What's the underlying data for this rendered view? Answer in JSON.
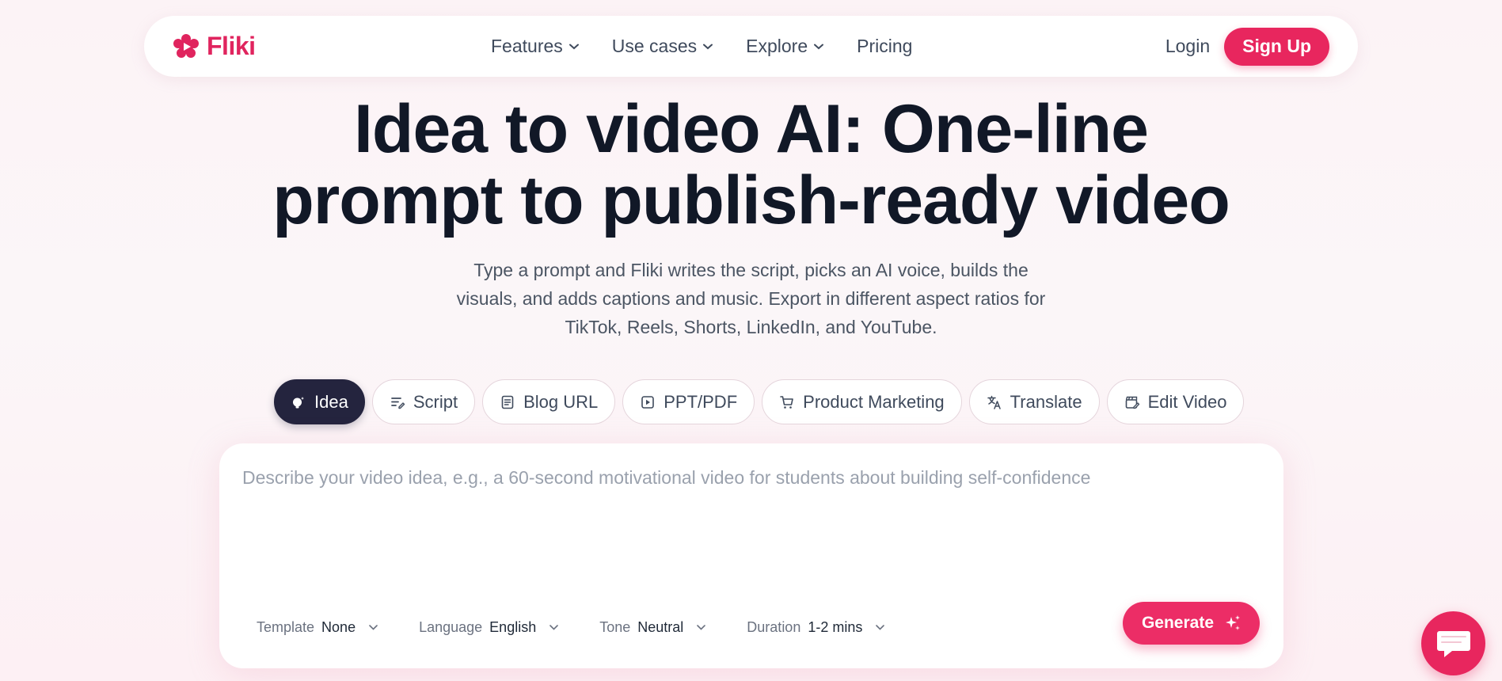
{
  "brand": {
    "name": "Fliki",
    "color": "#e0245e",
    "logo_icon": "flower-play-icon"
  },
  "nav": {
    "items": [
      {
        "label": "Features",
        "dropdown": true
      },
      {
        "label": "Use cases",
        "dropdown": true
      },
      {
        "label": "Explore",
        "dropdown": true
      },
      {
        "label": "Pricing",
        "dropdown": false
      }
    ],
    "login_label": "Login",
    "signup_label": "Sign Up"
  },
  "hero": {
    "title_line1": "Idea to video AI: One-line",
    "title_line2": "prompt to publish-ready video",
    "subtitle": "Type a prompt and Fliki writes the script, picks an AI voice, builds the visuals, and adds captions and music. Export in different aspect ratios for TikTok, Reels, Shorts, LinkedIn, and YouTube."
  },
  "tabs": [
    {
      "label": "Idea",
      "icon": "lightbulb-icon",
      "active": true
    },
    {
      "label": "Script",
      "icon": "script-lines-icon",
      "active": false
    },
    {
      "label": "Blog URL",
      "icon": "document-icon",
      "active": false
    },
    {
      "label": "PPT/PDF",
      "icon": "play-square-icon",
      "active": false
    },
    {
      "label": "Product Marketing",
      "icon": "shopping-cart-icon",
      "active": false
    },
    {
      "label": "Translate",
      "icon": "translate-icon",
      "active": false
    },
    {
      "label": "Edit Video",
      "icon": "clapperboard-edit-icon",
      "active": false
    }
  ],
  "prompt": {
    "placeholder": "Describe your video idea, e.g., a 60-second motivational video for students about building self-confidence",
    "value": ""
  },
  "options": {
    "template": {
      "label": "Template",
      "value": "None"
    },
    "language": {
      "label": "Language",
      "value": "English"
    },
    "tone": {
      "label": "Tone",
      "value": "Neutral"
    },
    "duration": {
      "label": "Duration",
      "value": "1-2 mins"
    }
  },
  "generate": {
    "label": "Generate",
    "icon": "sparkles-icon"
  },
  "chat_widget": {
    "icon": "chat-bubble-icon"
  },
  "colors": {
    "accent": "#e8265e",
    "dark": "#24243e",
    "heading": "#111827",
    "text": "#3f4a5c"
  }
}
